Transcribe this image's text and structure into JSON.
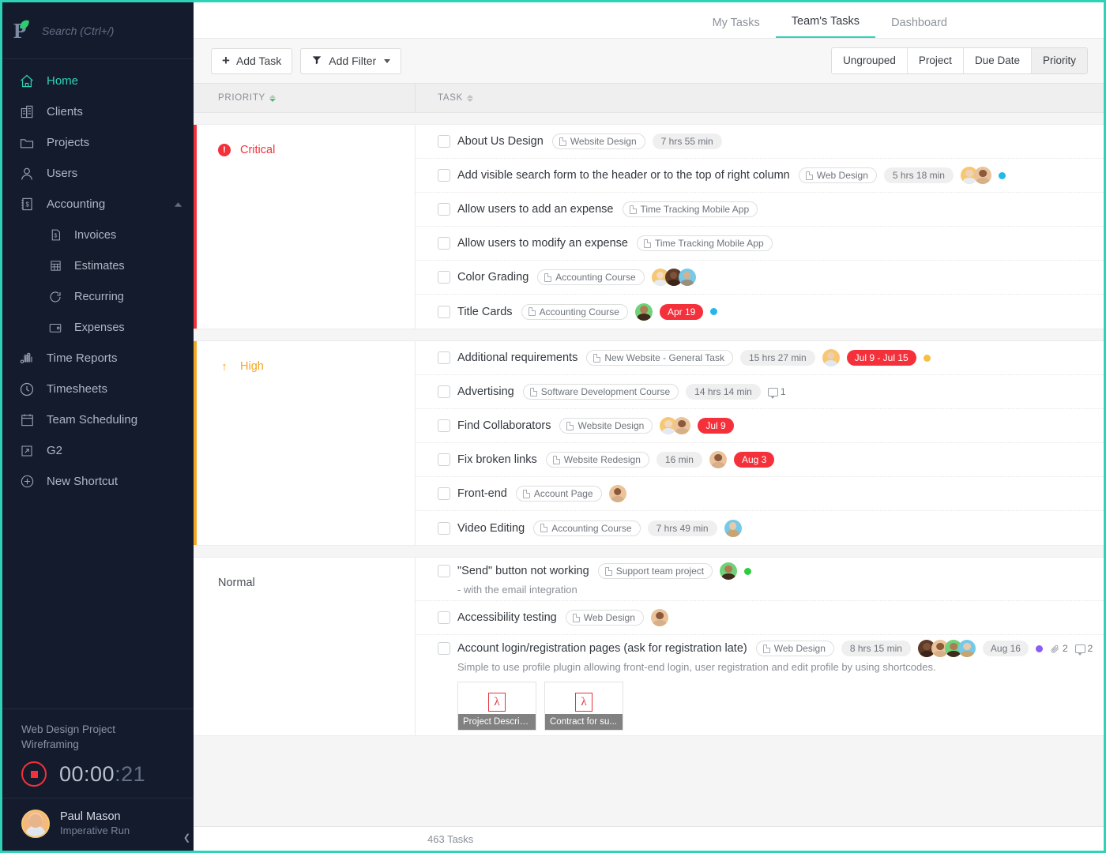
{
  "sidebar": {
    "search": {
      "placeholder": "Search (Ctrl+/)",
      "value": ""
    },
    "nav": [
      {
        "label": "Home",
        "icon": "home-icon"
      },
      {
        "label": "Clients",
        "icon": "buildings-icon"
      },
      {
        "label": "Projects",
        "icon": "folder-icon"
      },
      {
        "label": "Users",
        "icon": "user-icon"
      },
      {
        "label": "Accounting",
        "icon": "ledger-icon"
      },
      {
        "label": "Invoices",
        "icon": "invoice-icon"
      },
      {
        "label": "Estimates",
        "icon": "grid-icon"
      },
      {
        "label": "Recurring",
        "icon": "refresh-icon"
      },
      {
        "label": "Expenses",
        "icon": "wallet-icon"
      },
      {
        "label": "Time Reports",
        "icon": "bars-icon"
      },
      {
        "label": "Timesheets",
        "icon": "clock-icon"
      },
      {
        "label": "Team Scheduling",
        "icon": "calendar-icon"
      },
      {
        "label": "G2",
        "icon": "arrow-out-icon"
      },
      {
        "label": "New Shortcut",
        "icon": "plus-circle-icon"
      }
    ],
    "timer": {
      "project": "Web Design Project",
      "task": "Wireframing",
      "hours_minutes": "00:00",
      "seconds": "21"
    },
    "user": {
      "name": "Paul Mason",
      "company": "Imperative Run"
    }
  },
  "topbar": {
    "tabs": [
      {
        "label": "My Tasks",
        "active": false
      },
      {
        "label": "Team's Tasks",
        "active": true
      },
      {
        "label": "Dashboard",
        "active": false
      }
    ]
  },
  "toolbar": {
    "add_task": "Add Task",
    "add_filter": "Add Filter",
    "grouping": [
      {
        "label": "Ungrouped",
        "active": false
      },
      {
        "label": "Project",
        "active": false
      },
      {
        "label": "Due Date",
        "active": false
      },
      {
        "label": "Priority",
        "active": true
      }
    ]
  },
  "columns": {
    "priority": "PRIORITY",
    "task": "TASK"
  },
  "footer": {
    "count": "463 Tasks"
  },
  "colors": {
    "accent": "#2ed3b7",
    "critical": "#f4303a",
    "high": "#f5a623",
    "sidebar_bg": "#141b2d"
  },
  "groups": [
    {
      "priority": "Critical",
      "bar_color": "#f4303a",
      "icon": "exclamation-circle-icon",
      "tasks": [
        {
          "name": "About Us Design",
          "project": "Website Design",
          "time": "7 hrs 55 min",
          "avatars": [],
          "due": null,
          "dot": null,
          "comments": null,
          "attachments_count": null,
          "desc": null
        },
        {
          "name": "Add visible search form to the header or to the top of right column",
          "project": "Web Design",
          "time": "5 hrs 18 min",
          "avatars": [
            "#f7c873",
            "#e8a87c"
          ],
          "due": null,
          "dot": "#22b8e8",
          "comments": null,
          "attachments_count": null,
          "desc": null
        },
        {
          "name": "Allow users to add an expense",
          "project": "Time Tracking Mobile App",
          "time": null,
          "avatars": [],
          "due": null,
          "dot": null,
          "comments": null,
          "attachments_count": null,
          "desc": null
        },
        {
          "name": "Allow users to modify an expense",
          "project": "Time Tracking Mobile App",
          "time": null,
          "avatars": [],
          "due": null,
          "dot": null,
          "comments": null,
          "attachments_count": null,
          "desc": null
        },
        {
          "name": "Color Grading",
          "project": "Accounting Course",
          "time": null,
          "avatars": [
            "#f7c873",
            "#5c3a28",
            "#76c9e8"
          ],
          "due": null,
          "dot": null,
          "comments": null,
          "attachments_count": null,
          "desc": null
        },
        {
          "name": "Title Cards",
          "project": "Accounting Course",
          "time": null,
          "avatars": [
            "#6fd27a"
          ],
          "due": "Apr 19",
          "due_style": "red",
          "dot": "#22b8e8",
          "comments": null,
          "attachments_count": null,
          "desc": null
        }
      ]
    },
    {
      "priority": "High",
      "bar_color": "#f5a623",
      "icon": "arrow-up-icon",
      "tasks": [
        {
          "name": "Additional requirements",
          "project": "New Website - General Task",
          "time": "15 hrs 27 min",
          "avatars": [
            "#f7c873"
          ],
          "due": "Jul 9 - Jul 15",
          "due_style": "red",
          "dot": "#f5c042",
          "comments": null,
          "attachments_count": null,
          "desc": null
        },
        {
          "name": "Advertising",
          "project": "Software Development Course",
          "time": "14 hrs 14 min",
          "avatars": [],
          "due": null,
          "dot": null,
          "comments": "1",
          "attachments_count": null,
          "desc": null
        },
        {
          "name": "Find Collaborators",
          "project": "Website Design",
          "time": null,
          "avatars": [
            "#f7c873",
            "#e8a87c"
          ],
          "due": "Jul 9",
          "due_style": "red",
          "dot": null,
          "comments": null,
          "attachments_count": null,
          "desc": null
        },
        {
          "name": "Fix broken links",
          "project": "Website Redesign",
          "time": "16 min",
          "avatars": [
            "#e8a87c"
          ],
          "due": "Aug 3",
          "due_style": "red",
          "dot": null,
          "comments": null,
          "attachments_count": null,
          "desc": null
        },
        {
          "name": "Front-end",
          "project": "Account Page",
          "time": null,
          "avatars": [
            "#e8a87c"
          ],
          "due": null,
          "dot": null,
          "comments": null,
          "attachments_count": null,
          "desc": null
        },
        {
          "name": "Video Editing",
          "project": "Accounting Course",
          "time": "7 hrs 49 min",
          "avatars": [
            "#76c9e8"
          ],
          "due": null,
          "dot": null,
          "comments": null,
          "attachments_count": null,
          "desc": null
        }
      ]
    },
    {
      "priority": "Normal",
      "bar_color": "transparent",
      "icon": null,
      "tasks": [
        {
          "name": "\"Send\" button not working",
          "project": "Support team project",
          "time": null,
          "avatars": [
            "#6fd27a"
          ],
          "due": null,
          "dot": "#2ecc40",
          "comments": null,
          "attachments_count": null,
          "desc": "- with the email integration"
        },
        {
          "name": "Accessibility testing",
          "project": "Web Design",
          "time": null,
          "avatars": [
            "#e8a87c"
          ],
          "due": null,
          "dot": null,
          "comments": null,
          "attachments_count": null,
          "desc": null
        },
        {
          "name": "Account login/registration pages (ask for registration late)",
          "project": "Web Design",
          "time": "8 hrs 15 min",
          "avatars": [
            "#5c3a28",
            "#e8a87c",
            "#6fd27a",
            "#76c9e8"
          ],
          "due": "Aug 16",
          "due_style": "grey",
          "dot": "#8b5cf6",
          "comments": "2",
          "attachments_count": "2",
          "desc": "Simple to use profile plugin allowing front-end login, user registration and edit profile by using shortcodes.",
          "attachments": [
            {
              "name": "Project Descrip...",
              "type": "pdf"
            },
            {
              "name": "Contract for su...",
              "type": "pdf"
            }
          ]
        }
      ]
    }
  ]
}
